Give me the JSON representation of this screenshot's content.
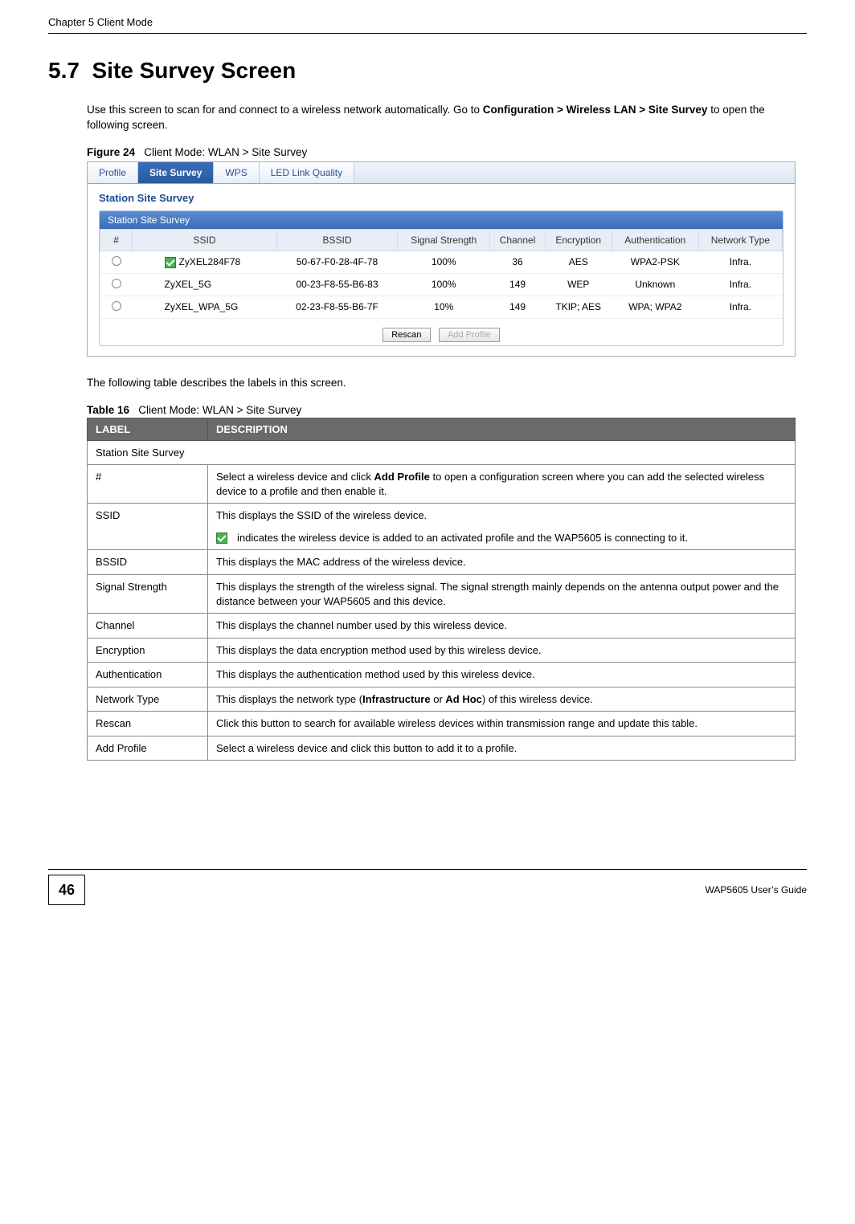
{
  "header": {
    "chapter": "Chapter 5 Client Mode"
  },
  "section": {
    "number": "5.7",
    "title": "Site Survey Screen",
    "intro_pre": "Use this screen to scan for and connect to a wireless network automatically. Go to ",
    "intro_bold": "Configuration > Wireless LAN > Site Survey",
    "intro_post": " to open the following screen."
  },
  "figure": {
    "label": "Figure 24",
    "caption": "Client Mode: WLAN > Site Survey"
  },
  "screenshot": {
    "tabs": [
      "Profile",
      "Site Survey",
      "WPS",
      "LED Link Quality"
    ],
    "active_tab_index": 1,
    "panel_title": "Station Site Survey",
    "panel_header": "Station Site Survey",
    "columns": [
      "#",
      "SSID",
      "BSSID",
      "Signal Strength",
      "Channel",
      "Encryption",
      "Authentication",
      "Network Type"
    ],
    "rows": [
      {
        "connected": true,
        "ssid": "ZyXEL284F78",
        "bssid": "50-67-F0-28-4F-78",
        "signal": "100%",
        "channel": "36",
        "encryption": "AES",
        "auth": "WPA2-PSK",
        "nettype": "Infra."
      },
      {
        "connected": false,
        "ssid": "ZyXEL_5G",
        "bssid": "00-23-F8-55-B6-83",
        "signal": "100%",
        "channel": "149",
        "encryption": "WEP",
        "auth": "Unknown",
        "nettype": "Infra."
      },
      {
        "connected": false,
        "ssid": "ZyXEL_WPA_5G",
        "bssid": "02-23-F8-55-B6-7F",
        "signal": "10%",
        "channel": "149",
        "encryption": "TKIP; AES",
        "auth": "WPA; WPA2",
        "nettype": "Infra."
      }
    ],
    "buttons": {
      "rescan": "Rescan",
      "add_profile": "Add Profile"
    }
  },
  "para_after_fig": "The following table describes the labels in this screen.",
  "table": {
    "label": "Table 16",
    "caption": "Client Mode: WLAN > Site Survey",
    "head": {
      "label": "LABEL",
      "desc": "DESCRIPTION"
    },
    "rows": [
      {
        "label": "Station Site Survey",
        "desc": "",
        "span": true
      },
      {
        "label": "#",
        "desc_pre": "Select a wireless device and click ",
        "desc_bold": "Add Profile",
        "desc_post": " to open a configuration screen where you can add the selected wireless device to a profile and then enable it."
      },
      {
        "label": "SSID",
        "desc": "This displays the SSID of the wireless device.",
        "icon_note": " indicates the wireless device is added to an activated profile and the WAP5605 is connecting to it."
      },
      {
        "label": "BSSID",
        "desc": "This displays the MAC address of the wireless device."
      },
      {
        "label": "Signal Strength",
        "desc": "This displays the strength of the wireless signal. The signal strength mainly depends on the antenna output power and the distance between your WAP5605 and this device."
      },
      {
        "label": "Channel",
        "desc": "This displays the channel number used by this wireless device."
      },
      {
        "label": "Encryption",
        "desc": "This displays the data encryption method used by this wireless device."
      },
      {
        "label": "Authentication",
        "desc": "This displays the authentication method used by this wireless device."
      },
      {
        "label": "Network Type",
        "desc_pre": "This displays the network type (",
        "desc_bold": "Infrastructure",
        "desc_mid": " or ",
        "desc_bold2": "Ad Hoc",
        "desc_post": ") of this wireless device."
      },
      {
        "label": "Rescan",
        "desc": "Click this button to search for available wireless devices within transmission range and update this table."
      },
      {
        "label": "Add Profile",
        "desc": "Select a wireless device and click this button to add it to a profile."
      }
    ]
  },
  "footer": {
    "page": "46",
    "guide": "WAP5605 User’s Guide"
  }
}
